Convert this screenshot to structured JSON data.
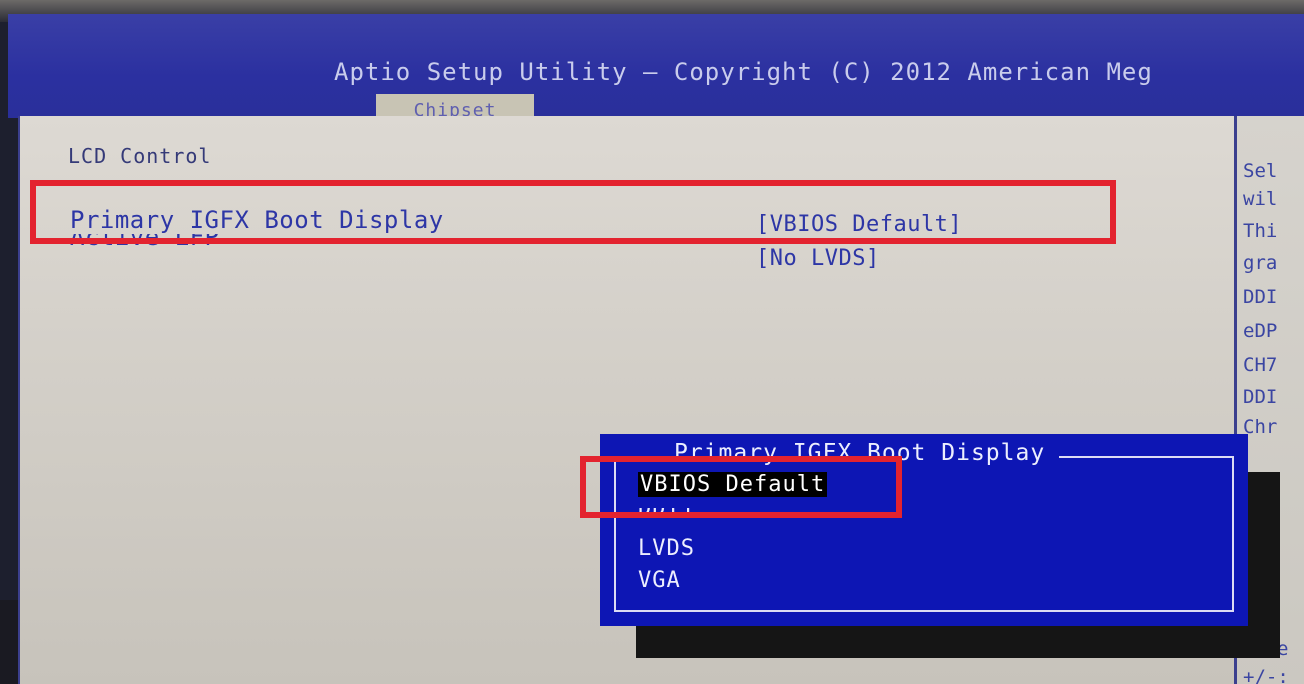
{
  "header": {
    "title": "Aptio Setup Utility – Copyright (C) 2012 American Meg",
    "active_tab": "Chipset"
  },
  "main": {
    "section": "LCD Control",
    "settings": [
      {
        "label": "Primary IGFX Boot Display",
        "value": "[VBIOS Default]"
      },
      {
        "label": "Active LFP",
        "value": "[No LVDS]"
      }
    ]
  },
  "help": {
    "lines": [
      "Sel",
      "wil",
      "Thi",
      "gra",
      "DDI",
      "eDP",
      "CH7",
      "DDI",
      "Chr",
      "e",
      "+/-:"
    ]
  },
  "popup": {
    "title": "Primary IGFX Boot Display",
    "options": [
      "VBIOS Default",
      "DDI1",
      "LVDS",
      "VGA"
    ],
    "selected_index": 0
  },
  "colors": {
    "header_bg": "#2b30a0",
    "panel_bg": "#d6d2cb",
    "text_blue": "#2d36a6",
    "popup_bg": "#0d16b4",
    "highlight_red": "#e3232f"
  }
}
